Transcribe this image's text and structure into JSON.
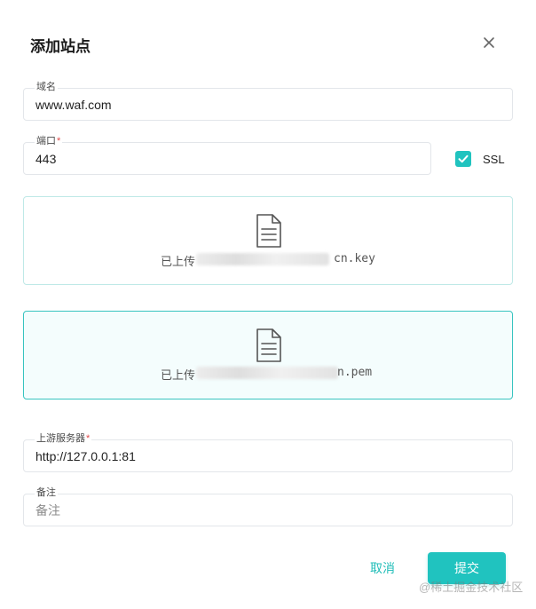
{
  "dialog": {
    "title": "添加站点",
    "close_icon": "close-icon"
  },
  "fields": {
    "domain": {
      "label": "域名",
      "value": "www.waf.com"
    },
    "port": {
      "label": "端口",
      "required_mark": "*",
      "value": "443"
    },
    "upstream": {
      "label": "上游服务器",
      "required_mark": "*",
      "value": "http://127.0.0.1:81"
    },
    "remark": {
      "label": "备注",
      "placeholder": "备注"
    }
  },
  "ssl": {
    "label": "SSL",
    "checked": true,
    "icon": "check-icon"
  },
  "uploads": {
    "key": {
      "status": "已上传",
      "filename_suffix": "cn.key",
      "icon": "file-document-icon"
    },
    "pem": {
      "status": "已上传",
      "filename_suffix": "n.pem",
      "icon": "file-document-icon"
    }
  },
  "actions": {
    "cancel_label": "取消",
    "submit_label": "提交"
  },
  "watermark": "@稀土掘金技术社区",
  "colors": {
    "accent": "#20c3bf",
    "accent_text": "#20bdb8",
    "required": "#e04b4b",
    "border": "#e3e6ea"
  }
}
